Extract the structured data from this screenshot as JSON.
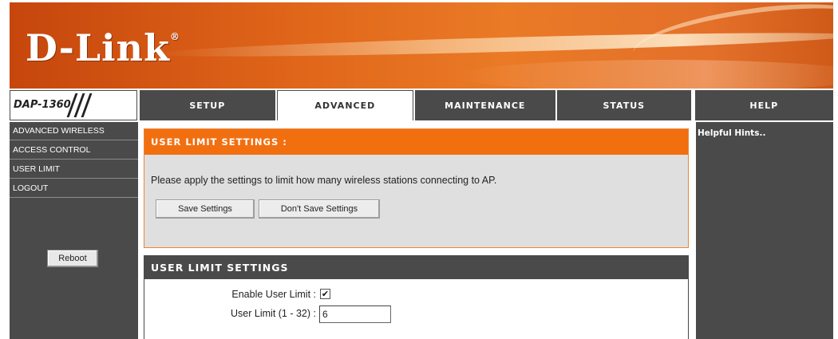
{
  "brand": {
    "logo": "D-Link",
    "reg_mark": "®"
  },
  "model": "DAP-1360",
  "tabs": [
    {
      "label": "SETUP",
      "active": false
    },
    {
      "label": "ADVANCED",
      "active": true
    },
    {
      "label": "MAINTENANCE",
      "active": false
    },
    {
      "label": "STATUS",
      "active": false
    },
    {
      "label": "HELP",
      "active": false
    }
  ],
  "sidebar": {
    "items": [
      {
        "label": "ADVANCED WIRELESS"
      },
      {
        "label": "ACCESS CONTROL"
      },
      {
        "label": "USER LIMIT"
      },
      {
        "label": "LOGOUT"
      }
    ],
    "reboot_label": "Reboot"
  },
  "intro": {
    "title": "USER LIMIT SETTINGS :",
    "text": "Please apply the settings to limit how many wireless stations connecting to AP.",
    "save_label": "Save Settings",
    "dont_save_label": "Don't Save Settings"
  },
  "settings": {
    "title": "USER LIMIT SETTINGS",
    "enable_label": "Enable User Limit :",
    "enable_checked": true,
    "enable_mark": "✔",
    "limit_label": "User Limit (1 - 32) :",
    "limit_value": "6"
  },
  "help": {
    "title": "Helpful Hints.."
  },
  "colors": {
    "accent_orange": "#f26f10",
    "nav_dark": "#4a4a4a",
    "panel_gray": "#dfdfdf"
  }
}
